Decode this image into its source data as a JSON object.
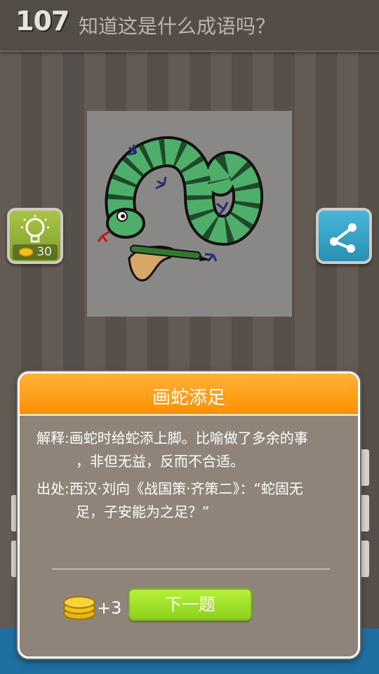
{
  "header": {
    "level": "107",
    "question": "知道这是什么成语吗？"
  },
  "hint": {
    "cost": "30"
  },
  "icons": {
    "hint": "lightbulb-icon",
    "share": "share-icon",
    "coin": "coin-stack-icon"
  },
  "dialog": {
    "title": "画蛇添足",
    "explanation_line1": "解释:画蛇时给蛇添上脚。比喻做了多余的事",
    "explanation_line2": "，非但无益，反而不合适。",
    "source_line1": "出处:西汉·刘向《战国策·齐策二》：“蛇固无",
    "source_line2": "足，子安能为之足？”",
    "reward": "+3",
    "next_label": "下一题"
  },
  "colors": {
    "dialog_header": "#ff9a10",
    "dialog_body": "#8f8479",
    "next_button": "#a2e22a",
    "bottom_bar": "#1f6fa3"
  }
}
